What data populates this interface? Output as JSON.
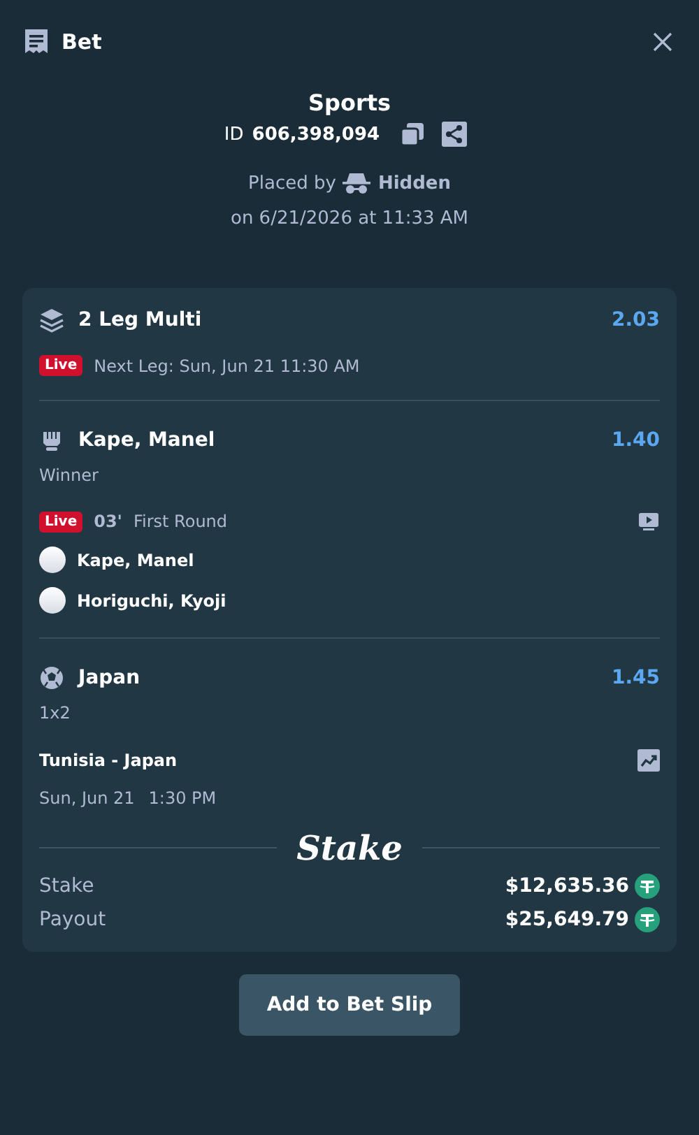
{
  "header": {
    "title": "Bet"
  },
  "summary": {
    "category": "Sports",
    "id_label": "ID",
    "id": "606,398,094",
    "placed_by": "Placed by",
    "user": "Hidden",
    "placed_on": "on 6/21/2026 at 11:33 AM"
  },
  "multi": {
    "title": "2 Leg Multi",
    "odds": "2.03",
    "live": true,
    "live_badge": "Live",
    "next_leg": "Next Leg: Sun, Jun 21 11:30 AM"
  },
  "legs": [
    {
      "kind": "fight",
      "title": "Kape, Manel",
      "odds": "1.40",
      "market": "Winner",
      "live": true,
      "live_badge": "Live",
      "clock": "03'",
      "period": "First Round",
      "competitors": [
        "Kape, Manel",
        "Horiguchi, Kyoji"
      ]
    },
    {
      "kind": "match",
      "title": "Japan",
      "odds": "1.45",
      "market": "1x2",
      "event": "Tunisia - Japan",
      "date": "Sun, Jun 21",
      "time": "1:30 PM"
    }
  ],
  "brand": "Stake",
  "totals": [
    {
      "label": "Stake",
      "amount": "$12,635.36"
    },
    {
      "label": "Payout",
      "amount": "$25,649.79"
    }
  ],
  "button": "Add to Bet Slip"
}
